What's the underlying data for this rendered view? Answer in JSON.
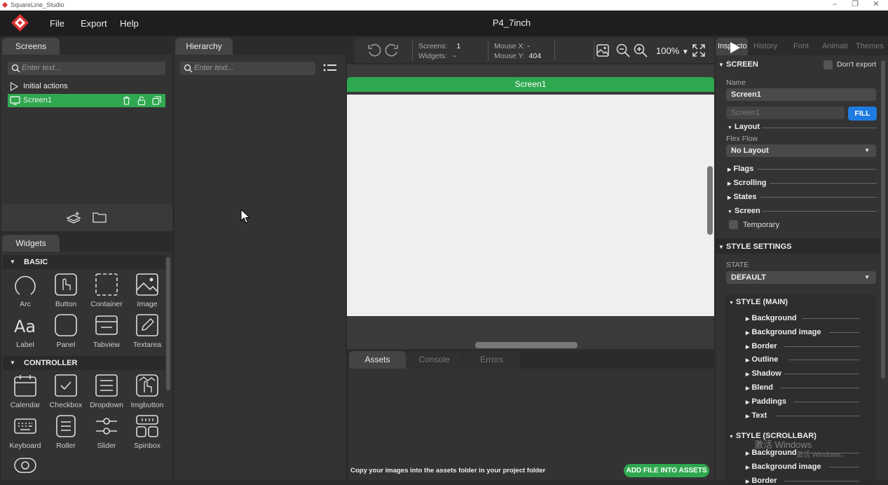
{
  "app": {
    "window_title": "SquareLine_Studio",
    "project_name": "P4_7inch"
  },
  "menu": {
    "file": "File",
    "export": "Export",
    "help": "Help"
  },
  "window_controls": {
    "minimize": "–",
    "maximize": "❐",
    "close": "✕"
  },
  "screens_panel": {
    "tab": "Screens",
    "search_placeholder": "Enter text...",
    "items": [
      {
        "label": "Initial actions"
      },
      {
        "label": "Screen1",
        "selected": true
      }
    ]
  },
  "hierarchy_panel": {
    "tab": "Hierarchy",
    "search_placeholder": "Enter text..."
  },
  "widgets_panel": {
    "tab": "Widgets",
    "basic_label": "BASIC",
    "basic": [
      "Arc",
      "Button",
      "Container",
      "Image",
      "Label",
      "Panel",
      "Tabview",
      "Textarea"
    ],
    "controller_label": "CONTROLLER",
    "controller": [
      "Calendar",
      "Checkbox",
      "Dropdown",
      "Imgbutton",
      "Keyboard",
      "Roller",
      "Slider",
      "Spinbox"
    ]
  },
  "toolbar": {
    "screens_label": "Screens:",
    "screens_value": "1",
    "widgets_label": "Widgets:",
    "widgets_value": "-",
    "mousex_label": "Mouse X:",
    "mousex_value": "-",
    "mousey_label": "Mouse Y:",
    "mousey_value": "404",
    "zoom": "100%"
  },
  "canvas": {
    "screen_title": "Screen1"
  },
  "bottom_panel": {
    "tabs": [
      "Assets",
      "Console",
      "Errors"
    ],
    "hint": "Copy your images into the assets folder in your project folder",
    "add_button": "ADD FILE INTO ASSETS"
  },
  "inspector": {
    "tabs": [
      "Inspecto",
      "History",
      "Font",
      "Animati",
      "Themes"
    ],
    "screen_section": "SCREEN",
    "dont_export": "Don't export",
    "name_label": "Name",
    "name_value": "Screen1",
    "fill_input": "Screen1",
    "fill_button": "FILL",
    "layout": "Layout",
    "flex_flow": "Flex Flow",
    "layout_select": "No Layout",
    "flags": "Flags",
    "scrolling": "Scrolling",
    "states": "States",
    "screen": "Screen",
    "temporary": "Temporary",
    "style_settings": "STYLE SETTINGS",
    "state_label": "STATE",
    "state_select": "DEFAULT",
    "style_main": "STYLE (MAIN)",
    "main_items": [
      "Background",
      "Background image",
      "Border",
      "Outline",
      "Shadow",
      "Blend",
      "Paddings",
      "Text"
    ],
    "style_scrollbar": "STYLE (SCROLLBAR)",
    "scroll_items": [
      "Background",
      "Background image",
      "Border"
    ]
  },
  "watermark": {
    "line1": "激活 Windows",
    "line2": "激活 Windows。"
  },
  "colors": {
    "accent_green": "#2fa84f",
    "fill_blue": "#1e7be0"
  }
}
